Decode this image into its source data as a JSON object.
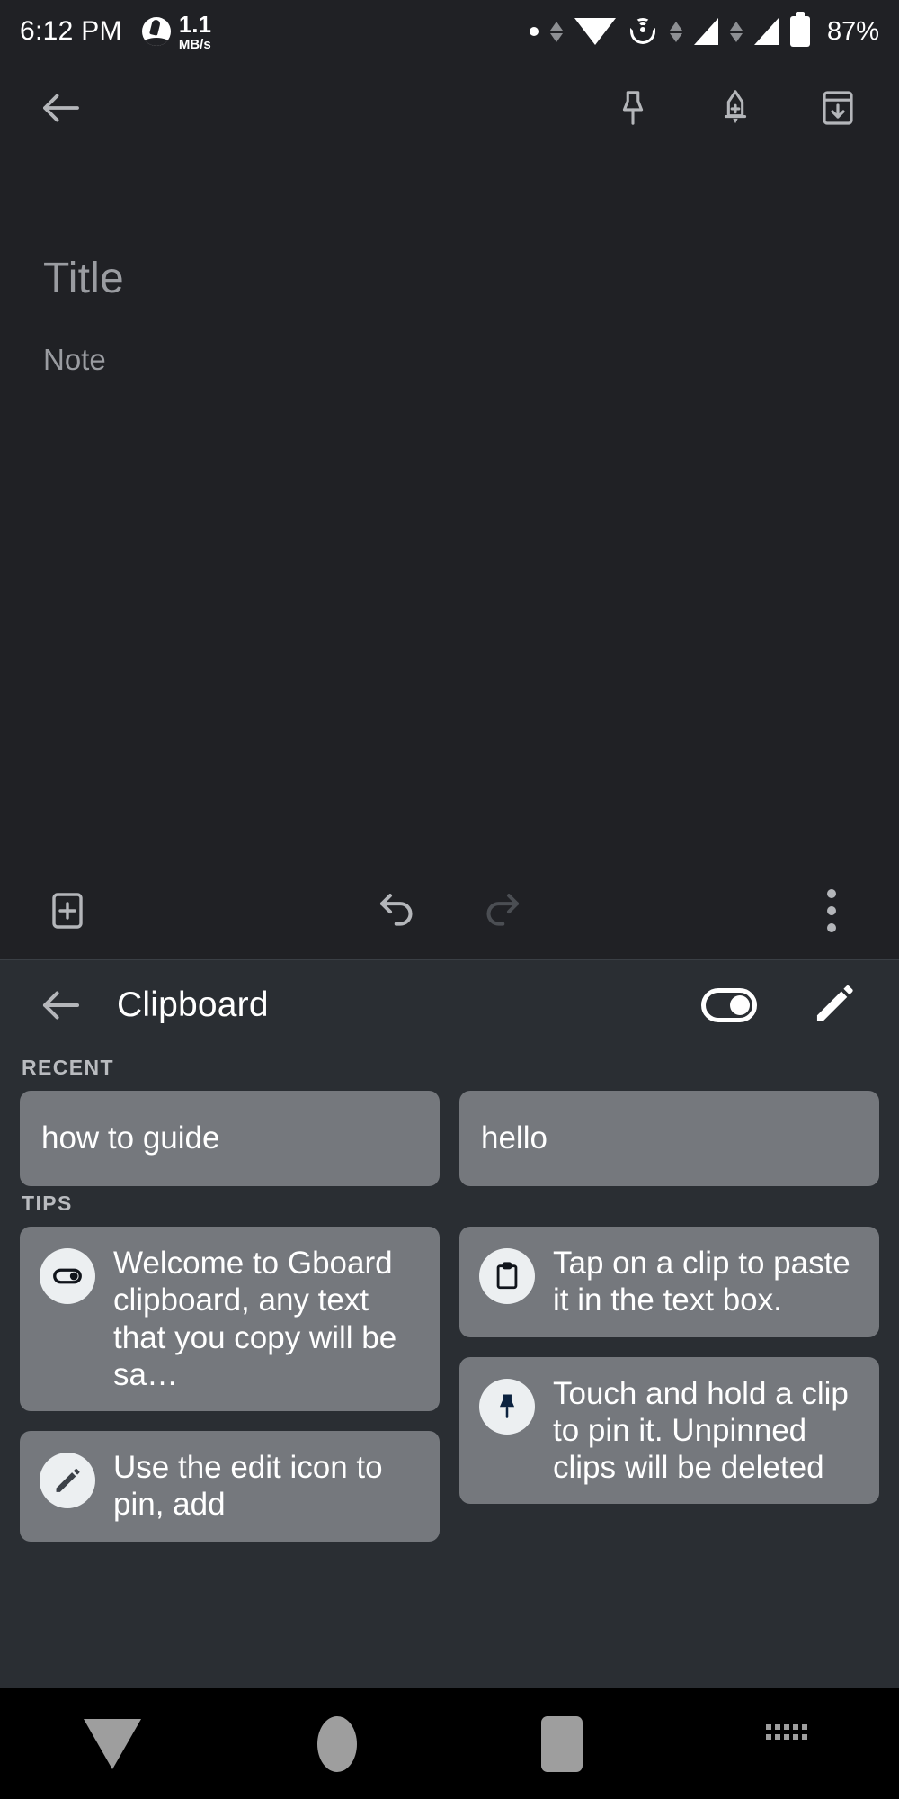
{
  "status_bar": {
    "time": "6:12 PM",
    "network_speed_value": "1.1",
    "network_speed_unit": "MB/s",
    "battery_percent": "87%",
    "icons": [
      "notification-dot",
      "data-transfer-arrows",
      "wifi-icon",
      "cast-icon",
      "data-transfer-arrows",
      "signal-icon",
      "data-transfer-arrows",
      "signal-icon",
      "battery-icon"
    ]
  },
  "note_app": {
    "toolbar": {
      "back_icon": "arrow-back-icon",
      "pin_icon": "pin-icon",
      "reminder_icon": "add-alarm-icon",
      "archive_icon": "archive-icon"
    },
    "editor": {
      "title_placeholder": "Title",
      "body_placeholder": "Note"
    },
    "bottom_bar": {
      "add_icon": "add-box-icon",
      "undo_icon": "undo-icon",
      "redo_icon": "redo-icon",
      "more_icon": "more-vert-icon"
    }
  },
  "clipboard": {
    "back_icon": "arrow-back-icon",
    "title": "Clipboard",
    "toggle": {
      "name": "clipboard-toggle",
      "state": "on"
    },
    "edit_icon": "pencil-icon",
    "recent_label": "RECENT",
    "recent_clips": [
      {
        "text": "how to guide"
      },
      {
        "text": "hello"
      }
    ],
    "tips_label": "TIPS",
    "tips": [
      {
        "icon": "toggle-icon",
        "text": "Welcome to Gboard clipboard, any text that you copy will be sa…"
      },
      {
        "icon": "clipboard-icon",
        "text": "Tap on a clip to paste it in the text box."
      },
      {
        "icon": "pin-icon",
        "text": "Touch and hold a clip to pin it. Unpinned clips will be deleted"
      },
      {
        "icon": "pencil-icon",
        "text": "Use the edit icon to pin, add"
      }
    ]
  },
  "nav_bar": {
    "back_icon": "hide-keyboard-icon",
    "home_icon": "home-circle-icon",
    "recents_icon": "recents-square-icon",
    "keyboard_switch_icon": "keyboard-switch-icon"
  },
  "colors": {
    "note_bg": "#202125",
    "clipboard_bg": "#2a2e33",
    "card_bg": "#75787d",
    "nav_bg": "#000000",
    "accent_text": "#ffffff",
    "muted_text": "#9a9ca1",
    "pin_navy": "#0d2340"
  }
}
